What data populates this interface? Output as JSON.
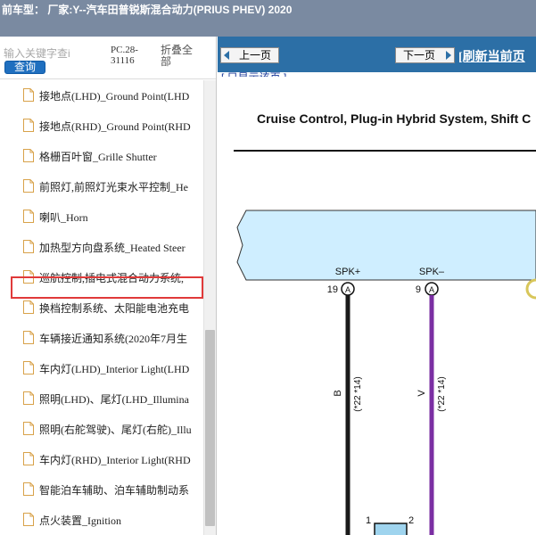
{
  "window": {
    "title": "前车型：  厂家:Y--汽车田普锐斯混合动力(PRIUS PHEV) 2020"
  },
  "search": {
    "placeholder": "输入关键字查i",
    "query_label": "查询",
    "pc_code": "PC.28-31116",
    "collapse_label": "折叠全部"
  },
  "tree": {
    "items": [
      {
        "label": "接地点(LHD)_Ground Point(LHD"
      },
      {
        "label": "接地点(RHD)_Ground Point(RHD"
      },
      {
        "label": "格栅百叶窗_Grille Shutter"
      },
      {
        "label": "前照灯,前照灯光束水平控制_He"
      },
      {
        "label": "喇叭_Horn"
      },
      {
        "label": "加热型方向盘系统_Heated Steer"
      },
      {
        "label": "巡航控制,插电式混合动力系统,"
      },
      {
        "label": "换档控制系统、太阳能电池充电"
      },
      {
        "label": "车辆接近通知系统(2020年7月生"
      },
      {
        "label": "车内灯(LHD)_Interior Light(LHD"
      },
      {
        "label": "照明(LHD)、尾灯(LHD_Illumina"
      },
      {
        "label": "照明(右舵驾驶)、尾灯(右舵)_Illu"
      },
      {
        "label": "车内灯(RHD)_Interior Light(RHD"
      },
      {
        "label": "智能泊车辅助、泊车辅助制动系"
      },
      {
        "label": "点火装置_Ignition"
      }
    ],
    "selected_index": 6
  },
  "viewer": {
    "prev_label": "上一页",
    "next_label": "下一页",
    "refresh_label": "[刷新当前页",
    "partial_link": "[ 只显示该页 ]",
    "diagram_title": "Cruise Control, Plug-in Hybrid System, Shift C",
    "pins": [
      {
        "name": "SPK+",
        "number": "19",
        "connector": "A",
        "wire_color": "B",
        "wire_code": "(*22 *14)",
        "terminal": "1"
      },
      {
        "name": "SPK–",
        "number": "9",
        "connector": "A",
        "wire_color": "V",
        "wire_code": "(*22 *14)",
        "terminal": "2"
      }
    ],
    "colors": {
      "ecu_fill": "#cfeeff",
      "wire_b": "#1a1a1a",
      "wire_v": "#7b2fa3",
      "nav_bar": "#2c6fa6",
      "selection": "#e03a3a"
    }
  }
}
